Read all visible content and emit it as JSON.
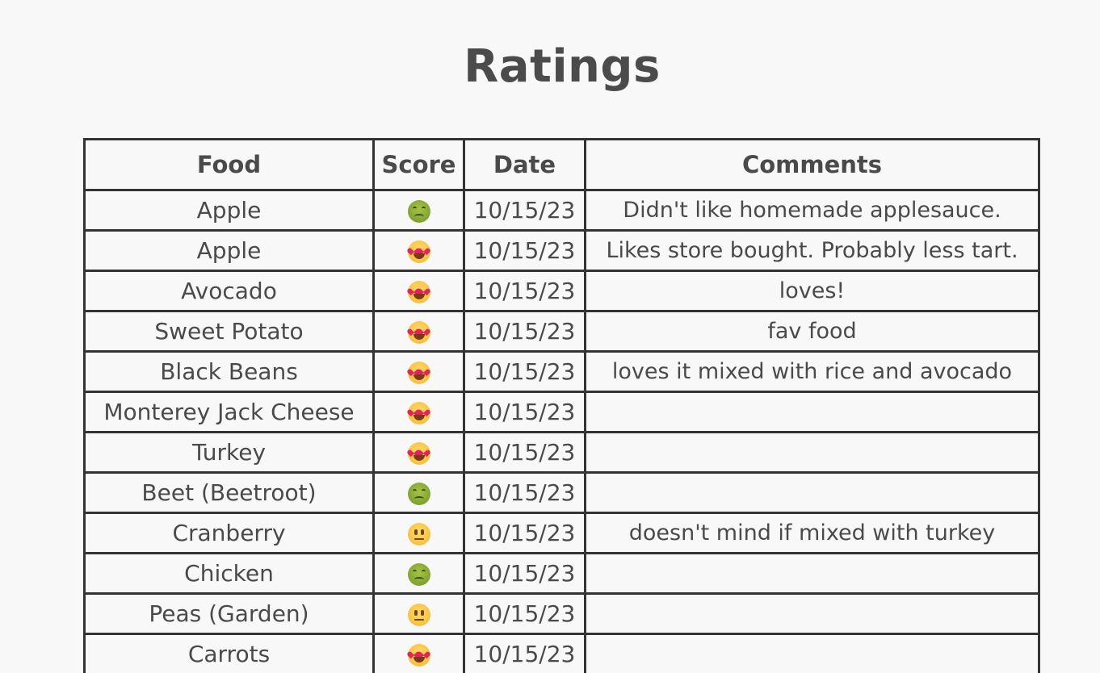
{
  "page": {
    "title": "Ratings"
  },
  "table": {
    "headers": {
      "food": "Food",
      "score": "Score",
      "date": "Date",
      "comments": "Comments"
    },
    "rows": [
      {
        "food": "Apple",
        "score_icon": "nauseated-face-icon",
        "date": "10/15/23",
        "comments": "Didn't like homemade applesauce."
      },
      {
        "food": "Apple",
        "score_icon": "heart-eyes-face-icon",
        "date": "10/15/23",
        "comments": "Likes store bought. Probably less tart."
      },
      {
        "food": "Avocado",
        "score_icon": "heart-eyes-face-icon",
        "date": "10/15/23",
        "comments": "loves!"
      },
      {
        "food": "Sweet Potato",
        "score_icon": "heart-eyes-face-icon",
        "date": "10/15/23",
        "comments": "fav food"
      },
      {
        "food": "Black Beans",
        "score_icon": "heart-eyes-face-icon",
        "date": "10/15/23",
        "comments": "loves it mixed with rice and avocado"
      },
      {
        "food": "Monterey Jack Cheese",
        "score_icon": "heart-eyes-face-icon",
        "date": "10/15/23",
        "comments": ""
      },
      {
        "food": "Turkey",
        "score_icon": "heart-eyes-face-icon",
        "date": "10/15/23",
        "comments": ""
      },
      {
        "food": "Beet (Beetroot)",
        "score_icon": "nauseated-face-icon",
        "date": "10/15/23",
        "comments": ""
      },
      {
        "food": "Cranberry",
        "score_icon": "neutral-face-icon",
        "date": "10/15/23",
        "comments": "doesn't mind if mixed with turkey"
      },
      {
        "food": "Chicken",
        "score_icon": "nauseated-face-icon",
        "date": "10/15/23",
        "comments": ""
      },
      {
        "food": "Peas (Garden)",
        "score_icon": "neutral-face-icon",
        "date": "10/15/23",
        "comments": ""
      },
      {
        "food": "Carrots",
        "score_icon": "heart-eyes-face-icon",
        "date": "10/15/23",
        "comments": ""
      }
    ]
  }
}
